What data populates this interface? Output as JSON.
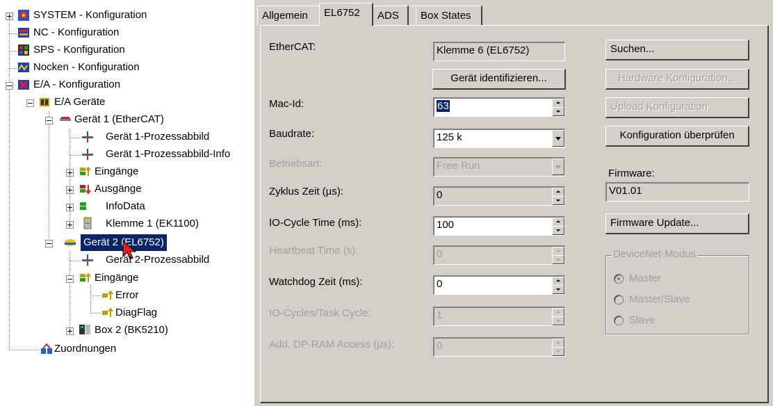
{
  "tree": {
    "items": [
      {
        "label": "SYSTEM - Konfiguration",
        "icon": "system-config-icon"
      },
      {
        "label": "NC - Konfiguration",
        "icon": "nc-config-icon"
      },
      {
        "label": "SPS - Konfiguration",
        "icon": "plc-config-icon"
      },
      {
        "label": "Nocken - Konfiguration",
        "icon": "cam-config-icon"
      },
      {
        "label": "E/A - Konfiguration",
        "icon": "io-config-icon"
      },
      {
        "label": "E/A Geräte",
        "icon": "io-devices-icon"
      },
      {
        "label": "Gerät 1 (EtherCAT)",
        "icon": "ethercat-device-icon"
      },
      {
        "label": "Gerät 1-Prozessabbild",
        "icon": "process-image-icon"
      },
      {
        "label": "Gerät 1-Prozessabbild-Info",
        "icon": "process-image-icon"
      },
      {
        "label": "Eingänge",
        "icon": "inputs-icon"
      },
      {
        "label": "Ausgänge",
        "icon": "outputs-icon"
      },
      {
        "label": "InfoData",
        "icon": "infodata-icon"
      },
      {
        "label": "Klemme 1 (EK1100)",
        "icon": "terminal-icon"
      },
      {
        "label": "Gerät 2 (EL6752)",
        "icon": "devicenet-device-icon"
      },
      {
        "label": "Gerät 2-Prozessabbild",
        "icon": "process-image-icon"
      },
      {
        "label": "Eingänge",
        "icon": "inputs-icon"
      },
      {
        "label": "Error",
        "icon": "input-variable-icon"
      },
      {
        "label": "DiagFlag",
        "icon": "input-variable-icon"
      },
      {
        "label": "Box 2 (BK5210)",
        "icon": "box-icon"
      },
      {
        "label": "Zuordnungen",
        "icon": "mappings-icon"
      }
    ]
  },
  "tabs": [
    "Allgemein",
    "EL6752",
    "ADS",
    "Box States"
  ],
  "active_tab": "EL6752",
  "form": {
    "ethercat_label": "EtherCAT:",
    "ethercat_value": "Klemme 6 (EL6752)",
    "identify_button": "Gerät identifizieren...",
    "macid_label": "Mac-Id:",
    "macid_value": "63",
    "baudrate_label": "Baudrate:",
    "baudrate_value": "125 k",
    "betriebsart_label": "Betriebsart:",
    "betriebsart_value": "Free Run",
    "zyklus_label": "Zyklus Zeit (µs):",
    "zyklus_value": "0",
    "iocycle_label": "IO-Cycle Time (ms):",
    "iocycle_value": "100",
    "heartbeat_label": "Heartbeat Time (s):",
    "heartbeat_value": "0",
    "watchdog_label": "Watchdog Zeit (ms):",
    "watchdog_value": "0",
    "iotask_label": "IO-Cycles/Task Cycle:",
    "iotask_value": "1",
    "dpram_label": "Add. DP-RAM Access (µs):",
    "dpram_value": "0"
  },
  "side": {
    "search_button": "Suchen...",
    "hw_config_button": "Hardware Konfiguration...",
    "upload_button": "Upload Konfiguration",
    "check_button": "Konfiguration überprüfen",
    "firmware_label": "Firmware:",
    "firmware_value": "V01.01",
    "firmware_update_button": "Firmware Update...",
    "devicenet_group": "DeviceNet-Modus",
    "modes": [
      "Master",
      "Master/Slave",
      "Slave"
    ]
  }
}
